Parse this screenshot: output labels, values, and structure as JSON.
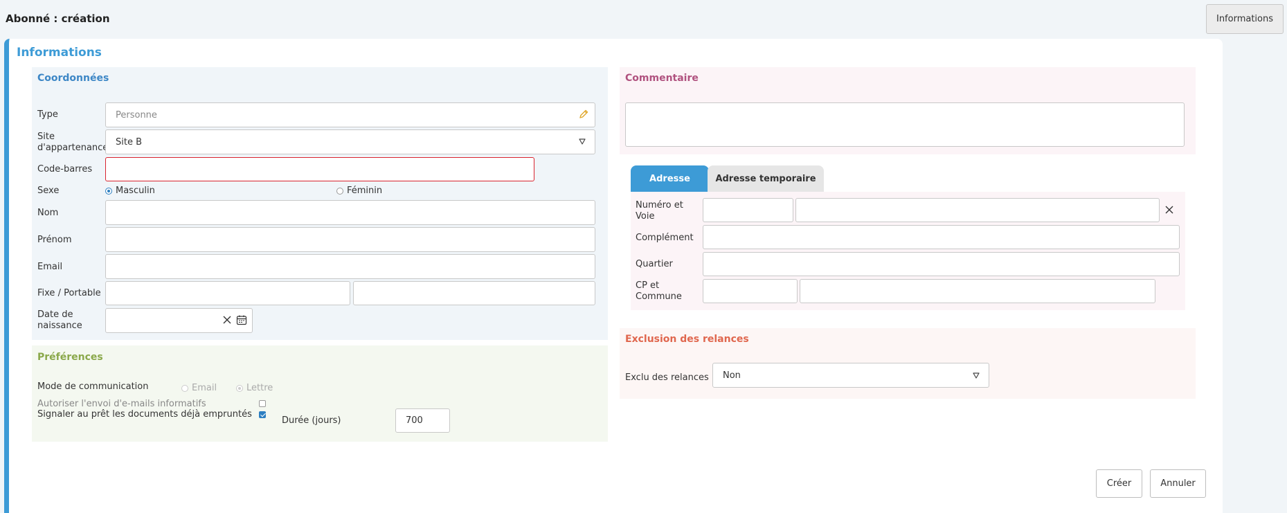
{
  "page": {
    "title": "Abonné : création",
    "top_button": "Informations"
  },
  "panel": {
    "title": "Informations"
  },
  "coordonnees": {
    "title": "Coordonnées",
    "type_label": "Type",
    "type_placeholder": "Personne",
    "site_label": "Site d'appartenance",
    "site_value": "Site B",
    "barcode_label": "Code-barres",
    "barcode_value": "",
    "sexe_label": "Sexe",
    "sexe_options": [
      "Masculin",
      "Féminin"
    ],
    "sexe_selected": "Masculin",
    "nom_label": "Nom",
    "nom_value": "",
    "prenom_label": "Prénom",
    "prenom_value": "",
    "email_label": "Email",
    "email_value": "",
    "phone_label": "Fixe / Portable",
    "fixe_value": "",
    "portable_value": "",
    "dob_label": "Date de naissance",
    "dob_value": ""
  },
  "preferences": {
    "title": "Préférences",
    "mode_label": "Mode de communication",
    "mode_options": [
      "Email",
      "Lettre"
    ],
    "mode_selected": "Lettre",
    "autoriser_label": "Autoriser l'envoi d'e-mails informatifs",
    "autoriser_checked": false,
    "signaler_label": "Signaler au prêt les documents déjà empruntés",
    "signaler_checked": true,
    "duree_label": "Durée (jours)",
    "duree_value": "700"
  },
  "commentaire": {
    "title": "Commentaire",
    "value": ""
  },
  "adresse": {
    "tabs": [
      {
        "label": "Adresse",
        "active": true
      },
      {
        "label": "Adresse temporaire",
        "active": false
      }
    ],
    "numero_label": "Numéro et Voie",
    "numero_value": "",
    "voie_value": "",
    "complement_label": "Complément",
    "complement_value": "",
    "quartier_label": "Quartier",
    "quartier_value": "",
    "cp_label": "CP et Commune",
    "cp_value": "",
    "commune_value": ""
  },
  "exclusion": {
    "title": "Exclusion des relances",
    "exclu_label": "Exclu des relances",
    "exclu_value": "Non"
  },
  "actions": {
    "create": "Créer",
    "cancel": "Annuler"
  },
  "colors": {
    "accent": "#3d9bd6",
    "coordonnees_head": "#3d87c6",
    "preferences_head": "#8aa84a",
    "commentaire_head": "#b0527f",
    "exclusion_head": "#e0674e",
    "error_border": "#d9232e",
    "edit_icon": "#e0a82e"
  }
}
